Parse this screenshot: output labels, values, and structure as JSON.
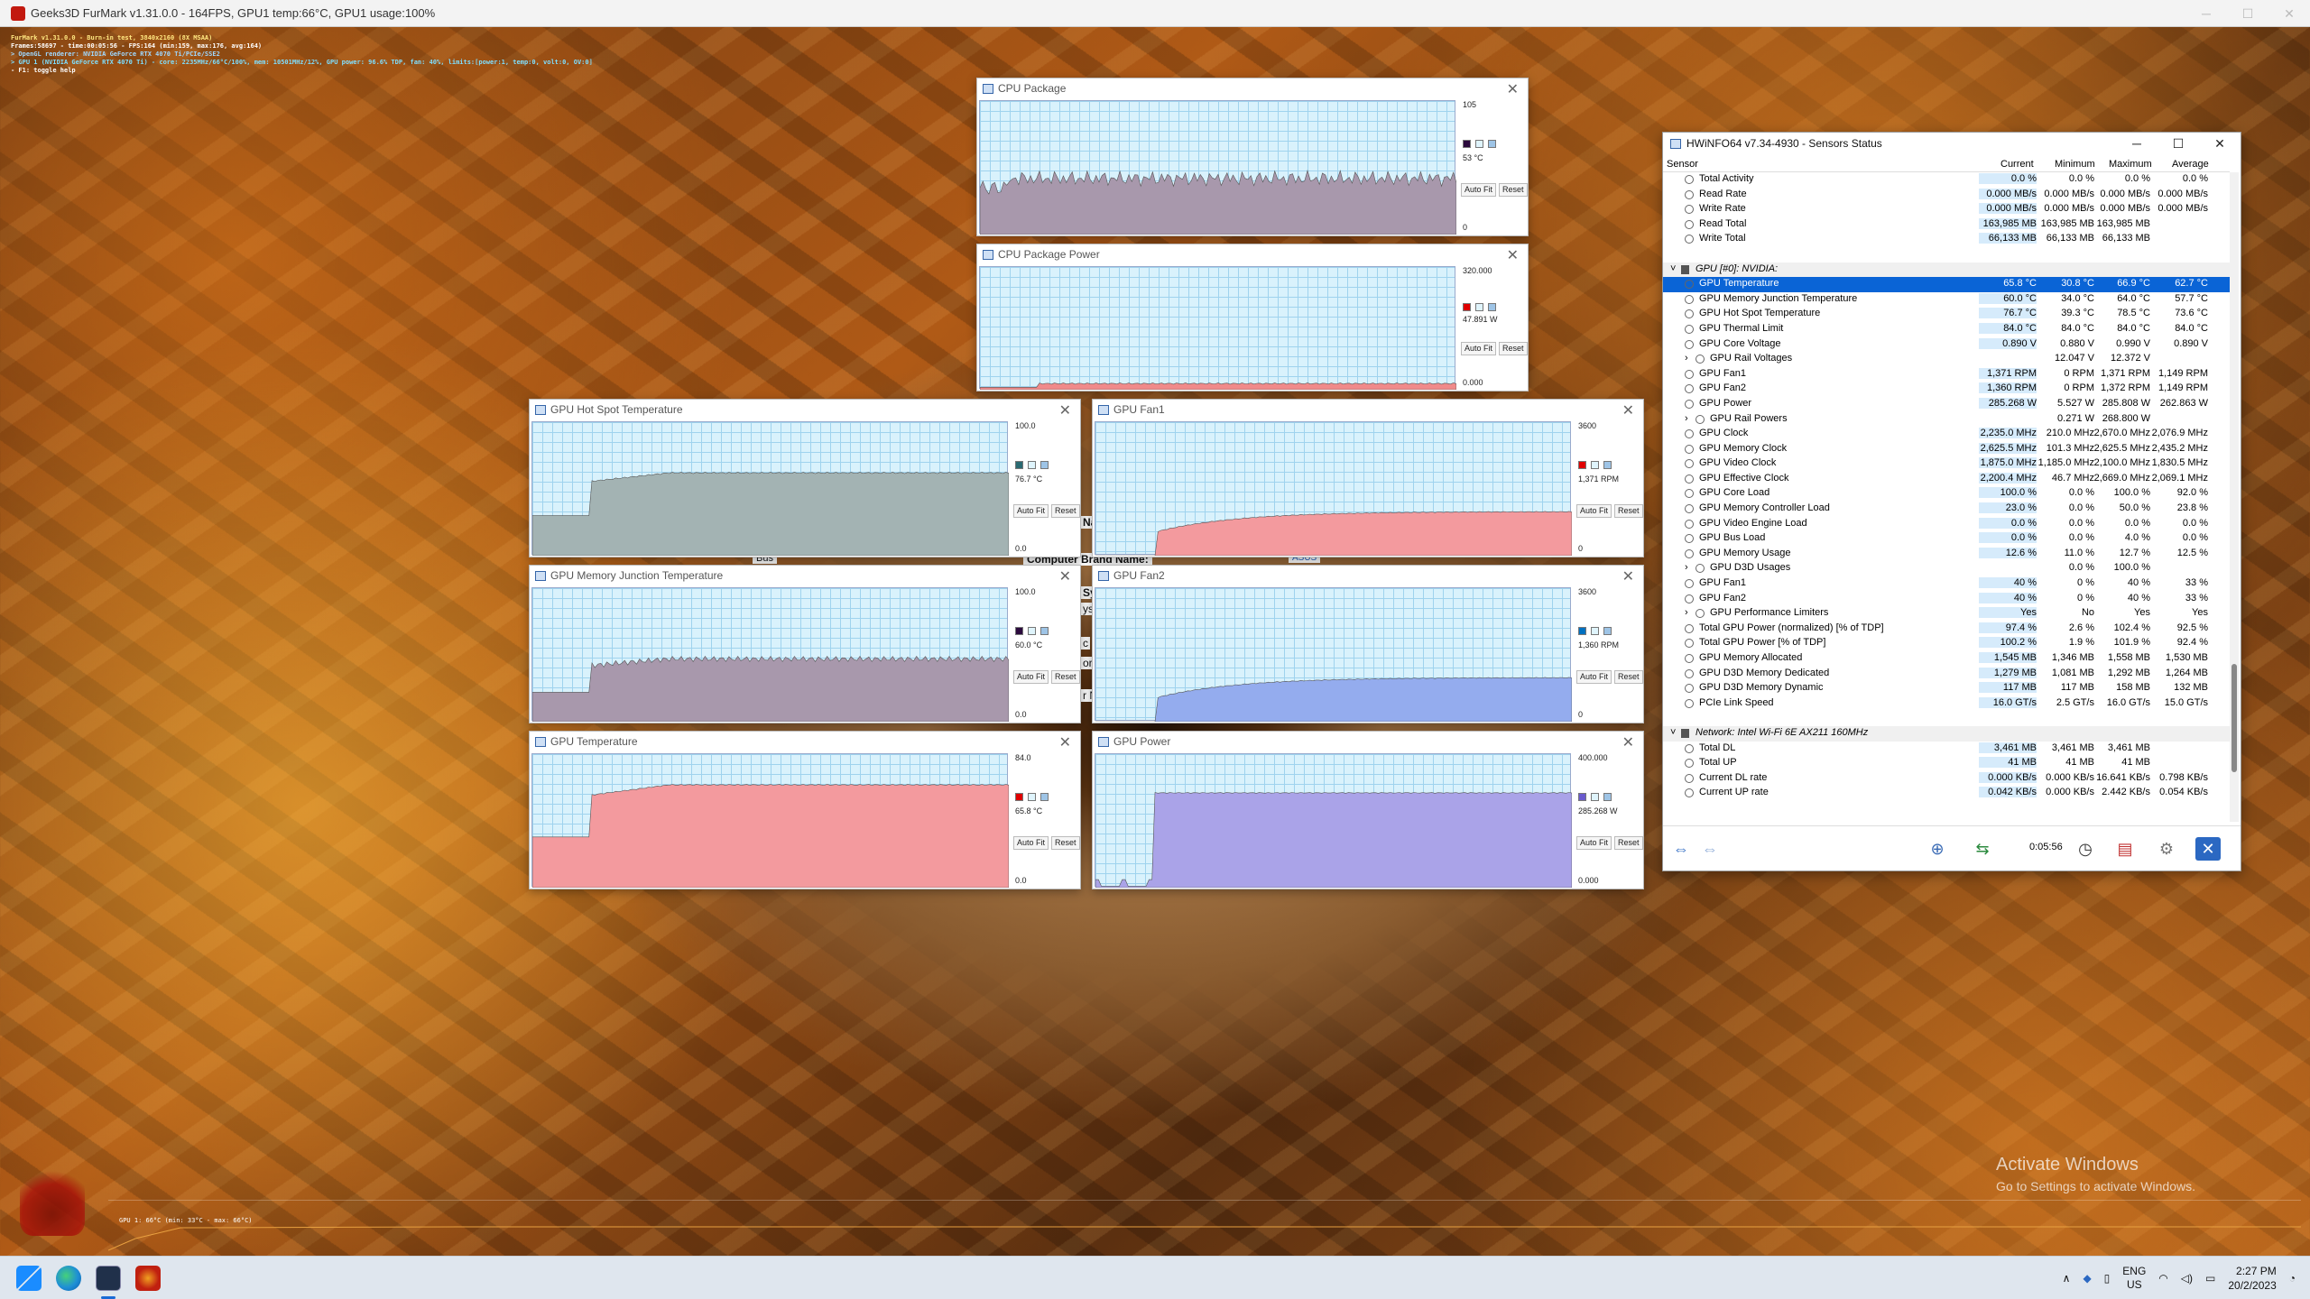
{
  "furmark": {
    "title": "Geeks3D FurMark v1.31.0.0 - 164FPS, GPU1 temp:66°C, GPU1 usage:100%",
    "overlay": [
      "FurMark v1.31.0.0 - Burn-in test, 3840x2160 (8X MSAA)",
      "Frames:58697 - time:00:05:56 - FPS:164 (min:159, max:176, avg:164)",
      "> OpenGL renderer: NVIDIA GeForce RTX 4070 Ti/PCIe/SSE2",
      "> GPU 1 (NVIDIA GeForce RTX 4070 Ti) - core: 2235MHz/66°C/100%, mem: 10501MHz/12%, GPU power: 96.6% TDP, fan: 40%, limits:[power:1, temp:0, volt:0, OV:0]",
      "- F1: toggle help"
    ],
    "graph_label": "GPU 1: 66°C (min: 33°C - max: 66°C)"
  },
  "graph_windows": [
    {
      "title": "CPU Package",
      "max": "105",
      "current": "53 °C",
      "min": "0",
      "color": "#2b0a3d",
      "fill": "#a898ac"
    },
    {
      "title": "CPU Package Power",
      "max": "320.000",
      "current": "47.891 W",
      "min": "0.000",
      "color": "#e00000",
      "fill": "#f08a8a"
    },
    {
      "title": "GPU Hot Spot Temperature",
      "max": "100.0",
      "current": "76.7 °C",
      "min": "0.0",
      "color": "#2a6a72",
      "fill": "#a3b3b3"
    },
    {
      "title": "GPU Fan1",
      "max": "3600",
      "current": "1,371 RPM",
      "min": "0",
      "color": "#e00000",
      "fill": "#f39a9e"
    },
    {
      "title": "GPU Memory Junction Temperature",
      "max": "100.0",
      "current": "60.0 °C",
      "min": "0.0",
      "color": "#2b0a3d",
      "fill": "#a898ac"
    },
    {
      "title": "GPU Fan2",
      "max": "3600",
      "current": "1,360 RPM",
      "min": "0",
      "color": "#0070c0",
      "fill": "#94acee"
    },
    {
      "title": "GPU Temperature",
      "max": "84.0",
      "current": "65.8 °C",
      "min": "0.0",
      "color": "#e00000",
      "fill": "#f39a9e"
    },
    {
      "title": "GPU Power",
      "max": "400.000",
      "current": "285.268 W",
      "min": "0.000",
      "color": "#6a5acd",
      "fill": "#aaa3e8"
    }
  ],
  "graph_buttons": {
    "autofit": "Auto Fit",
    "reset": "Reset"
  },
  "behind_text": {
    "brand_label": "Computer Brand Name:",
    "brand_value": "ASUS",
    "bus": "Bus",
    "na": "Na",
    "sy": "Sy",
    "ys": "ys",
    "c": "c",
    "or": "or",
    "rn": "r N"
  },
  "hwinfo": {
    "title": "HWiNFO64 v7.34-4930 - Sensors Status",
    "columns": [
      "Sensor",
      "Current",
      "Minimum",
      "Maximum",
      "Average"
    ],
    "rows": [
      {
        "name": "Total Activity",
        "cur": "0.0 %",
        "min": "0.0 %",
        "max": "0.0 %",
        "avg": "0.0 %"
      },
      {
        "name": "Read Rate",
        "cur": "0.000 MB/s",
        "min": "0.000 MB/s",
        "max": "0.000 MB/s",
        "avg": "0.000 MB/s"
      },
      {
        "name": "Write Rate",
        "cur": "0.000 MB/s",
        "min": "0.000 MB/s",
        "max": "0.000 MB/s",
        "avg": "0.000 MB/s"
      },
      {
        "name": "Read Total",
        "cur": "163,985 MB",
        "min": "163,985 MB",
        "max": "163,985 MB",
        "avg": ""
      },
      {
        "name": "Write Total",
        "cur": "66,133 MB",
        "min": "66,133 MB",
        "max": "66,133 MB",
        "avg": ""
      },
      {
        "name": "",
        "cur": "",
        "min": "",
        "max": "",
        "avg": "",
        "blank": true
      },
      {
        "name": "GPU [#0]: NVIDIA:",
        "cur": "",
        "min": "",
        "max": "",
        "avg": "",
        "group": true
      },
      {
        "name": "GPU Temperature",
        "cur": "65.8 °C",
        "min": "30.8 °C",
        "max": "66.9 °C",
        "avg": "62.7 °C",
        "sel": true
      },
      {
        "name": "GPU Memory Junction Temperature",
        "cur": "60.0 °C",
        "min": "34.0 °C",
        "max": "64.0 °C",
        "avg": "57.7 °C"
      },
      {
        "name": "GPU Hot Spot Temperature",
        "cur": "76.7 °C",
        "min": "39.3 °C",
        "max": "78.5 °C",
        "avg": "73.6 °C"
      },
      {
        "name": "GPU Thermal Limit",
        "cur": "84.0 °C",
        "min": "84.0 °C",
        "max": "84.0 °C",
        "avg": "84.0 °C"
      },
      {
        "name": "GPU Core Voltage",
        "cur": "0.890 V",
        "min": "0.880 V",
        "max": "0.990 V",
        "avg": "0.890 V"
      },
      {
        "name": "GPU Rail Voltages",
        "cur": "",
        "min": "12.047 V",
        "max": "12.372 V",
        "avg": "",
        "sub": true
      },
      {
        "name": "GPU Fan1",
        "cur": "1,371 RPM",
        "min": "0 RPM",
        "max": "1,371 RPM",
        "avg": "1,149 RPM"
      },
      {
        "name": "GPU Fan2",
        "cur": "1,360 RPM",
        "min": "0 RPM",
        "max": "1,372 RPM",
        "avg": "1,149 RPM"
      },
      {
        "name": "GPU Power",
        "cur": "285.268 W",
        "min": "5.527 W",
        "max": "285.808 W",
        "avg": "262.863 W"
      },
      {
        "name": "GPU Rail Powers",
        "cur": "",
        "min": "0.271 W",
        "max": "268.800 W",
        "avg": "",
        "sub": true
      },
      {
        "name": "GPU Clock",
        "cur": "2,235.0 MHz",
        "min": "210.0 MHz",
        "max": "2,670.0 MHz",
        "avg": "2,076.9 MHz"
      },
      {
        "name": "GPU Memory Clock",
        "cur": "2,625.5 MHz",
        "min": "101.3 MHz",
        "max": "2,625.5 MHz",
        "avg": "2,435.2 MHz"
      },
      {
        "name": "GPU Video Clock",
        "cur": "1,875.0 MHz",
        "min": "1,185.0 MHz",
        "max": "2,100.0 MHz",
        "avg": "1,830.5 MHz"
      },
      {
        "name": "GPU Effective Clock",
        "cur": "2,200.4 MHz",
        "min": "46.7 MHz",
        "max": "2,669.0 MHz",
        "avg": "2,069.1 MHz"
      },
      {
        "name": "GPU Core Load",
        "cur": "100.0 %",
        "min": "0.0 %",
        "max": "100.0 %",
        "avg": "92.0 %"
      },
      {
        "name": "GPU Memory Controller Load",
        "cur": "23.0 %",
        "min": "0.0 %",
        "max": "50.0 %",
        "avg": "23.8 %"
      },
      {
        "name": "GPU Video Engine Load",
        "cur": "0.0 %",
        "min": "0.0 %",
        "max": "0.0 %",
        "avg": "0.0 %"
      },
      {
        "name": "GPU Bus Load",
        "cur": "0.0 %",
        "min": "0.0 %",
        "max": "4.0 %",
        "avg": "0.0 %"
      },
      {
        "name": "GPU Memory Usage",
        "cur": "12.6 %",
        "min": "11.0 %",
        "max": "12.7 %",
        "avg": "12.5 %"
      },
      {
        "name": "GPU D3D Usages",
        "cur": "",
        "min": "0.0 %",
        "max": "100.0 %",
        "avg": "",
        "sub": true
      },
      {
        "name": "GPU Fan1",
        "cur": "40 %",
        "min": "0 %",
        "max": "40 %",
        "avg": "33 %"
      },
      {
        "name": "GPU Fan2",
        "cur": "40 %",
        "min": "0 %",
        "max": "40 %",
        "avg": "33 %"
      },
      {
        "name": "GPU Performance Limiters",
        "cur": "Yes",
        "min": "No",
        "max": "Yes",
        "avg": "Yes",
        "sub": true
      },
      {
        "name": "Total GPU Power (normalized) [% of TDP]",
        "cur": "97.4 %",
        "min": "2.6 %",
        "max": "102.4 %",
        "avg": "92.5 %"
      },
      {
        "name": "Total GPU Power [% of TDP]",
        "cur": "100.2 %",
        "min": "1.9 %",
        "max": "101.9 %",
        "avg": "92.4 %"
      },
      {
        "name": "GPU Memory Allocated",
        "cur": "1,545 MB",
        "min": "1,346 MB",
        "max": "1,558 MB",
        "avg": "1,530 MB"
      },
      {
        "name": "GPU D3D Memory Dedicated",
        "cur": "1,279 MB",
        "min": "1,081 MB",
        "max": "1,292 MB",
        "avg": "1,264 MB"
      },
      {
        "name": "GPU D3D Memory Dynamic",
        "cur": "117 MB",
        "min": "117 MB",
        "max": "158 MB",
        "avg": "132 MB"
      },
      {
        "name": "PCIe Link Speed",
        "cur": "16.0 GT/s",
        "min": "2.5 GT/s",
        "max": "16.0 GT/s",
        "avg": "15.0 GT/s"
      },
      {
        "name": "",
        "cur": "",
        "min": "",
        "max": "",
        "avg": "",
        "blank": true
      },
      {
        "name": "Network: Intel Wi-Fi 6E AX211 160MHz",
        "cur": "",
        "min": "",
        "max": "",
        "avg": "",
        "group": true
      },
      {
        "name": "Total DL",
        "cur": "3,461 MB",
        "min": "3,461 MB",
        "max": "3,461 MB",
        "avg": ""
      },
      {
        "name": "Total UP",
        "cur": "41 MB",
        "min": "41 MB",
        "max": "41 MB",
        "avg": ""
      },
      {
        "name": "Current DL rate",
        "cur": "0.000 KB/s",
        "min": "0.000 KB/s",
        "max": "16.641 KB/s",
        "avg": "0.798 KB/s"
      },
      {
        "name": "Current UP rate",
        "cur": "0.042 KB/s",
        "min": "0.000 KB/s",
        "max": "2.442 KB/s",
        "avg": "0.054 KB/s"
      }
    ],
    "timer": "0:05:56"
  },
  "activate": {
    "line1": "Activate Windows",
    "line2": "Go to Settings to activate Windows."
  },
  "tray": {
    "lang1": "ENG",
    "lang2": "US",
    "time": "2:27 PM",
    "date": "20/2/2023"
  }
}
